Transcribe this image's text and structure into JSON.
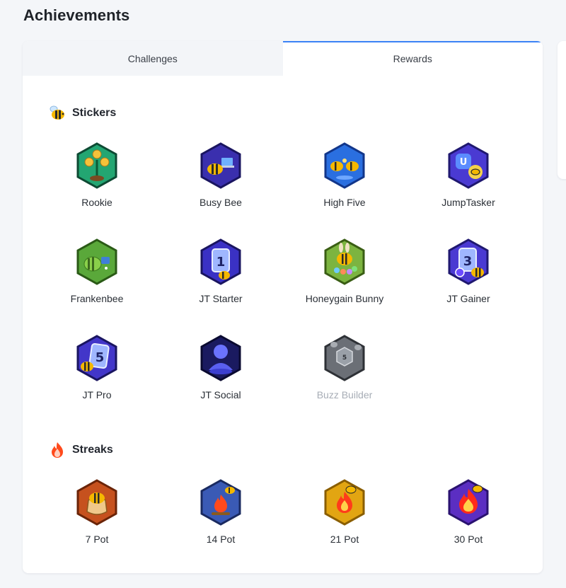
{
  "page": {
    "title": "Achievements"
  },
  "tabs": [
    {
      "label": "Challenges",
      "active": false
    },
    {
      "label": "Rewards",
      "active": true
    }
  ],
  "sections": {
    "stickers": {
      "title": "Stickers",
      "icon": "bee-icon",
      "items": [
        {
          "label": "Rookie",
          "icon": "money-plant-icon",
          "locked": false
        },
        {
          "label": "Busy Bee",
          "icon": "bee-laptop-icon",
          "locked": false
        },
        {
          "label": "High Five",
          "icon": "bees-high-five-icon",
          "locked": false
        },
        {
          "label": "JumpTasker",
          "icon": "jumptask-app-icon",
          "locked": false
        },
        {
          "label": "Frankenbee",
          "icon": "frankenbee-icon",
          "locked": false
        },
        {
          "label": "JT Starter",
          "icon": "card-number-one-icon",
          "locked": false
        },
        {
          "label": "Honeygain Bunny",
          "icon": "honeygain-bunny-icon",
          "locked": false
        },
        {
          "label": "JT Gainer",
          "icon": "card-number-three-icon",
          "locked": false
        },
        {
          "label": "JT Pro",
          "icon": "card-number-five-icon",
          "locked": false
        },
        {
          "label": "JT Social",
          "icon": "social-avatar-icon",
          "locked": false
        },
        {
          "label": "Buzz Builder",
          "icon": "buzz-builder-locked-icon",
          "locked": true
        }
      ]
    },
    "streaks": {
      "title": "Streaks",
      "icon": "fire-icon",
      "items": [
        {
          "label": "7 Pot",
          "icon": "honey-pot-icon",
          "locked": false
        },
        {
          "label": "14 Pot",
          "icon": "campfire-icon",
          "locked": false
        },
        {
          "label": "21 Pot",
          "icon": "flame-gold-icon",
          "locked": false
        },
        {
          "label": "30 Pot",
          "icon": "flame-purple-icon",
          "locked": false
        }
      ]
    }
  },
  "colors": {
    "accent": "#3b82f6",
    "locked_text": "#a7adb6",
    "badge_bg": [
      "#1f9e6b",
      "#3a2fae",
      "#2a6fe0",
      "#4a3ad2",
      "#5aa83a",
      "#3a31c4",
      "#7cb440",
      "#4a3ad2",
      "#4236c9",
      "#1a1a60",
      "#6b6f76",
      "#c6511e",
      "#3a5ab5",
      "#e2a512",
      "#5b2ec2"
    ]
  }
}
